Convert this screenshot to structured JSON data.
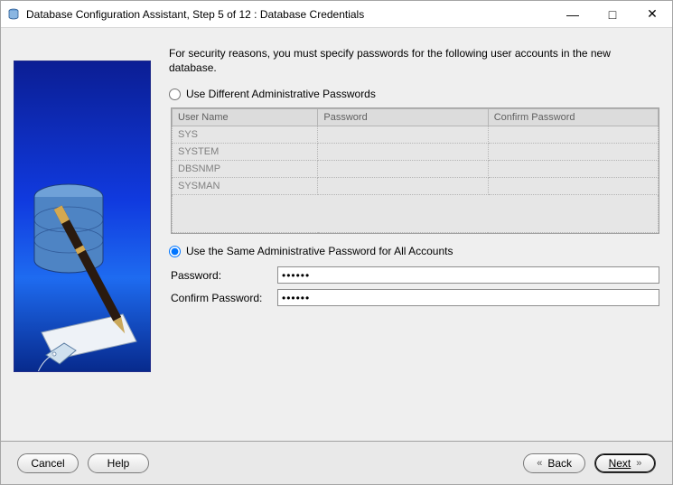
{
  "window": {
    "title": "Database Configuration Assistant, Step 5 of 12 : Database Credentials"
  },
  "main": {
    "description": "For security reasons, you must specify passwords for the following user accounts in the new database.",
    "option_different": "Use Different Administrative Passwords",
    "option_same": "Use the Same Administrative Password for All Accounts",
    "table": {
      "col_user": "User Name",
      "col_password": "Password",
      "col_confirm": "Confirm Password",
      "rows": [
        {
          "user": "SYS"
        },
        {
          "user": "SYSTEM"
        },
        {
          "user": "DBSNMP"
        },
        {
          "user": "SYSMAN"
        }
      ]
    },
    "password_label": "Password:",
    "confirm_label": "Confirm Password:",
    "password_value": "******",
    "confirm_value": "******"
  },
  "footer": {
    "cancel": "Cancel",
    "help": "Help",
    "back": "Back",
    "next": "Next"
  }
}
